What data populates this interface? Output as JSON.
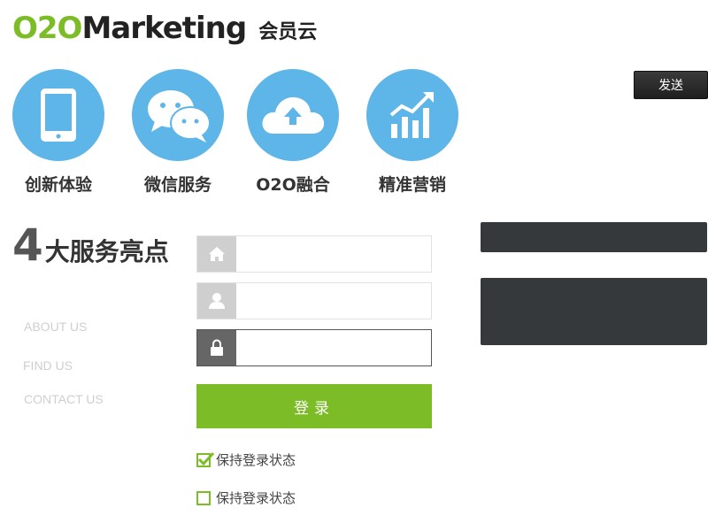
{
  "logo": {
    "o2o": "O2O",
    "marketing": "Marketing",
    "subtitle": "会员云"
  },
  "send_button": "发送",
  "features": [
    {
      "label": "创新体验",
      "icon": "tablet-icon"
    },
    {
      "label": "微信服务",
      "icon": "wechat-icon"
    },
    {
      "label": "O2O融合",
      "icon": "cloud-upload-icon"
    },
    {
      "label": "精准营销",
      "icon": "growth-chart-icon"
    }
  ],
  "highlight": {
    "number": "4",
    "text": "大服务亮点"
  },
  "nav": [
    {
      "label": "ABOUT US"
    },
    {
      "label": "FIND US"
    },
    {
      "label": "CONTACT US"
    }
  ],
  "form": {
    "field1": {
      "value": "",
      "icon": "home-icon"
    },
    "field2": {
      "value": "",
      "icon": "user-icon"
    },
    "field3": {
      "value": "",
      "icon": "lock-icon"
    },
    "login_label": "登录",
    "remember_checked_label": "保持登录状态",
    "remember_unchecked_label": "保持登录状态"
  },
  "colors": {
    "accent": "#7cbd27",
    "feature_circle": "#5eb5e8",
    "dark_panel": "#36393c"
  }
}
